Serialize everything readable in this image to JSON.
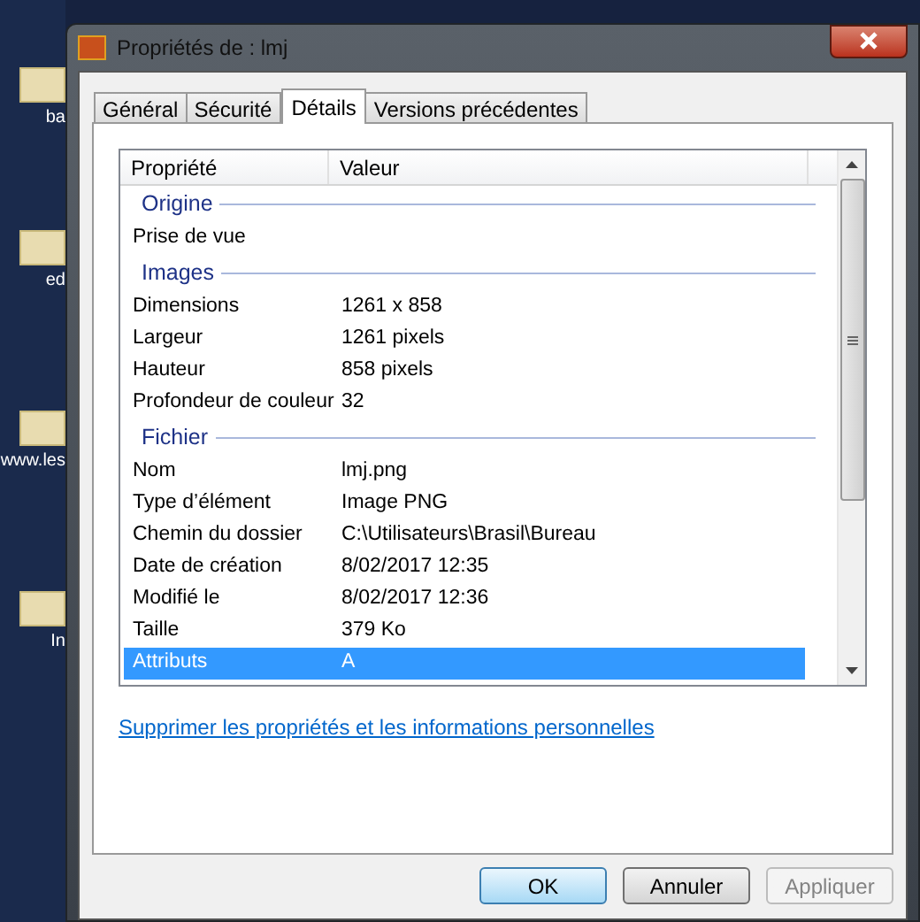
{
  "desktop_icons": [
    {
      "label": "ba"
    },
    {
      "label": "ed"
    },
    {
      "label": "www.les"
    },
    {
      "label": "In"
    }
  ],
  "window": {
    "title": "Propriétés de : lmj"
  },
  "tabs": [
    {
      "label": "Général",
      "selected": false
    },
    {
      "label": "Sécurité",
      "selected": false
    },
    {
      "label": "Détails",
      "selected": true
    },
    {
      "label": "Versions précédentes",
      "selected": false
    }
  ],
  "table": {
    "columns": [
      "Propriété",
      "Valeur"
    ],
    "groups": [
      {
        "title": "Origine",
        "rows": [
          {
            "property": "Prise de vue",
            "value": "",
            "selected": false
          }
        ]
      },
      {
        "title": "Images",
        "rows": [
          {
            "property": "Dimensions",
            "value": "1261 x 858",
            "selected": false
          },
          {
            "property": "Largeur",
            "value": "1261 pixels",
            "selected": false
          },
          {
            "property": "Hauteur",
            "value": "858 pixels",
            "selected": false
          },
          {
            "property": "Profondeur de couleur",
            "value": "32",
            "selected": false
          }
        ]
      },
      {
        "title": "Fichier",
        "rows": [
          {
            "property": "Nom",
            "value": "lmj.png",
            "selected": false
          },
          {
            "property": "Type d’élément",
            "value": "Image PNG",
            "selected": false
          },
          {
            "property": "Chemin du dossier",
            "value": "C:\\Utilisateurs\\Brasil\\Bureau",
            "selected": false
          },
          {
            "property": "Date de création",
            "value": "8/02/2017 12:35",
            "selected": false
          },
          {
            "property": "Modifié le",
            "value": "8/02/2017 12:36",
            "selected": false
          },
          {
            "property": "Taille",
            "value": "379 Ko",
            "selected": false
          },
          {
            "property": "Attributs",
            "value": "A",
            "selected": true
          }
        ]
      }
    ]
  },
  "link": "Supprimer les propriétés et les informations personnelles",
  "buttons": [
    {
      "label": "OK",
      "disabled": false,
      "default": true
    },
    {
      "label": "Annuler",
      "disabled": false,
      "default": false
    },
    {
      "label": "Appliquer",
      "disabled": true,
      "default": false
    }
  ]
}
